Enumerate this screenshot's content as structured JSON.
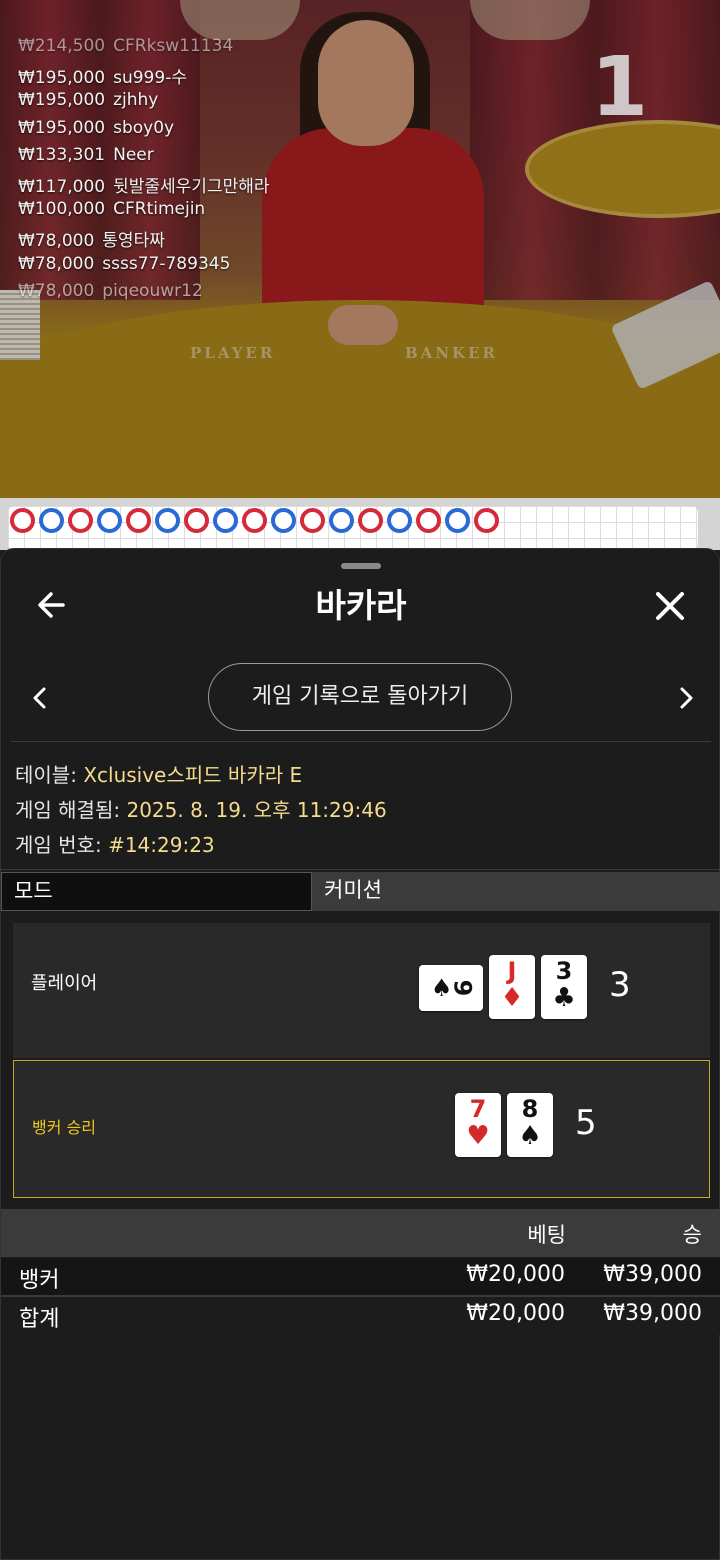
{
  "video": {
    "countdown": "1",
    "table_left_text": "PLAYER",
    "table_right_text": "BANKER",
    "winners": [
      {
        "amount": "₩214,500",
        "user": "CFRksw11134"
      },
      {
        "amount": "₩195,000",
        "user": "su999-수"
      },
      {
        "amount": "₩195,000",
        "user": "zjhhy"
      },
      {
        "amount": "₩195,000",
        "user": "sboy0y"
      },
      {
        "amount": "₩133,301",
        "user": "Neer"
      },
      {
        "amount": "₩117,000",
        "user": "뒷발줄세우기그만해라"
      },
      {
        "amount": "₩100,000",
        "user": "CFRtimejin"
      },
      {
        "amount": "₩78,000",
        "user": "통영타짜"
      },
      {
        "amount": "₩78,000",
        "user": "ssss77-789345"
      },
      {
        "amount": "₩78,000",
        "user": "piqeouwr12"
      }
    ]
  },
  "roadmap": {
    "beads": [
      "B",
      "P",
      "B",
      "P",
      "B",
      "P",
      "B",
      "P",
      "B",
      "P",
      "B",
      "P",
      "B",
      "P",
      "B",
      "P",
      "B"
    ],
    "colors": {
      "banker": "#d42a3a",
      "player": "#2a6ad4",
      "tie": "#1f8a3a"
    }
  },
  "header": {
    "title": "바카라",
    "back_icon": "arrow-left-icon",
    "close_icon": "close-icon"
  },
  "nav": {
    "return_label": "게임 기록으로 돌아가기"
  },
  "info": {
    "table_label": "테이블:",
    "table_value": "Xclusive스피드 바카라 E",
    "resolved_label": "게임 해결됨:",
    "resolved_value": "2025. 8. 19. 오후 11:29:46",
    "number_label": "게임 번호:",
    "number_value": "#14:29:23"
  },
  "tabs": [
    {
      "label": "모드"
    },
    {
      "label": "커미션"
    }
  ],
  "hands": {
    "player": {
      "label": "플레이어",
      "score": "3",
      "cards": [
        {
          "rank": "9",
          "suit": "♠",
          "color": "black",
          "sideways": true
        },
        {
          "rank": "J",
          "suit": "♦",
          "color": "red",
          "sideways": false
        },
        {
          "rank": "3",
          "suit": "♣",
          "color": "black",
          "sideways": false
        }
      ]
    },
    "banker": {
      "label": "뱅커 승리",
      "score": "5",
      "cards": [
        {
          "rank": "7",
          "suit": "♥",
          "color": "red",
          "sideways": false
        },
        {
          "rank": "8",
          "suit": "♠",
          "color": "black",
          "sideways": false
        }
      ]
    }
  },
  "bets": {
    "col_bet": "베팅",
    "col_win": "승",
    "rows": [
      {
        "label": "뱅커",
        "bet": "₩20,000",
        "win": "₩39,000"
      }
    ],
    "total": {
      "label": "합계",
      "bet": "₩20,000",
      "win": "₩39,000"
    }
  },
  "colors": {
    "accent_gold": "#f0c820",
    "info_value": "#f4dc8c"
  }
}
